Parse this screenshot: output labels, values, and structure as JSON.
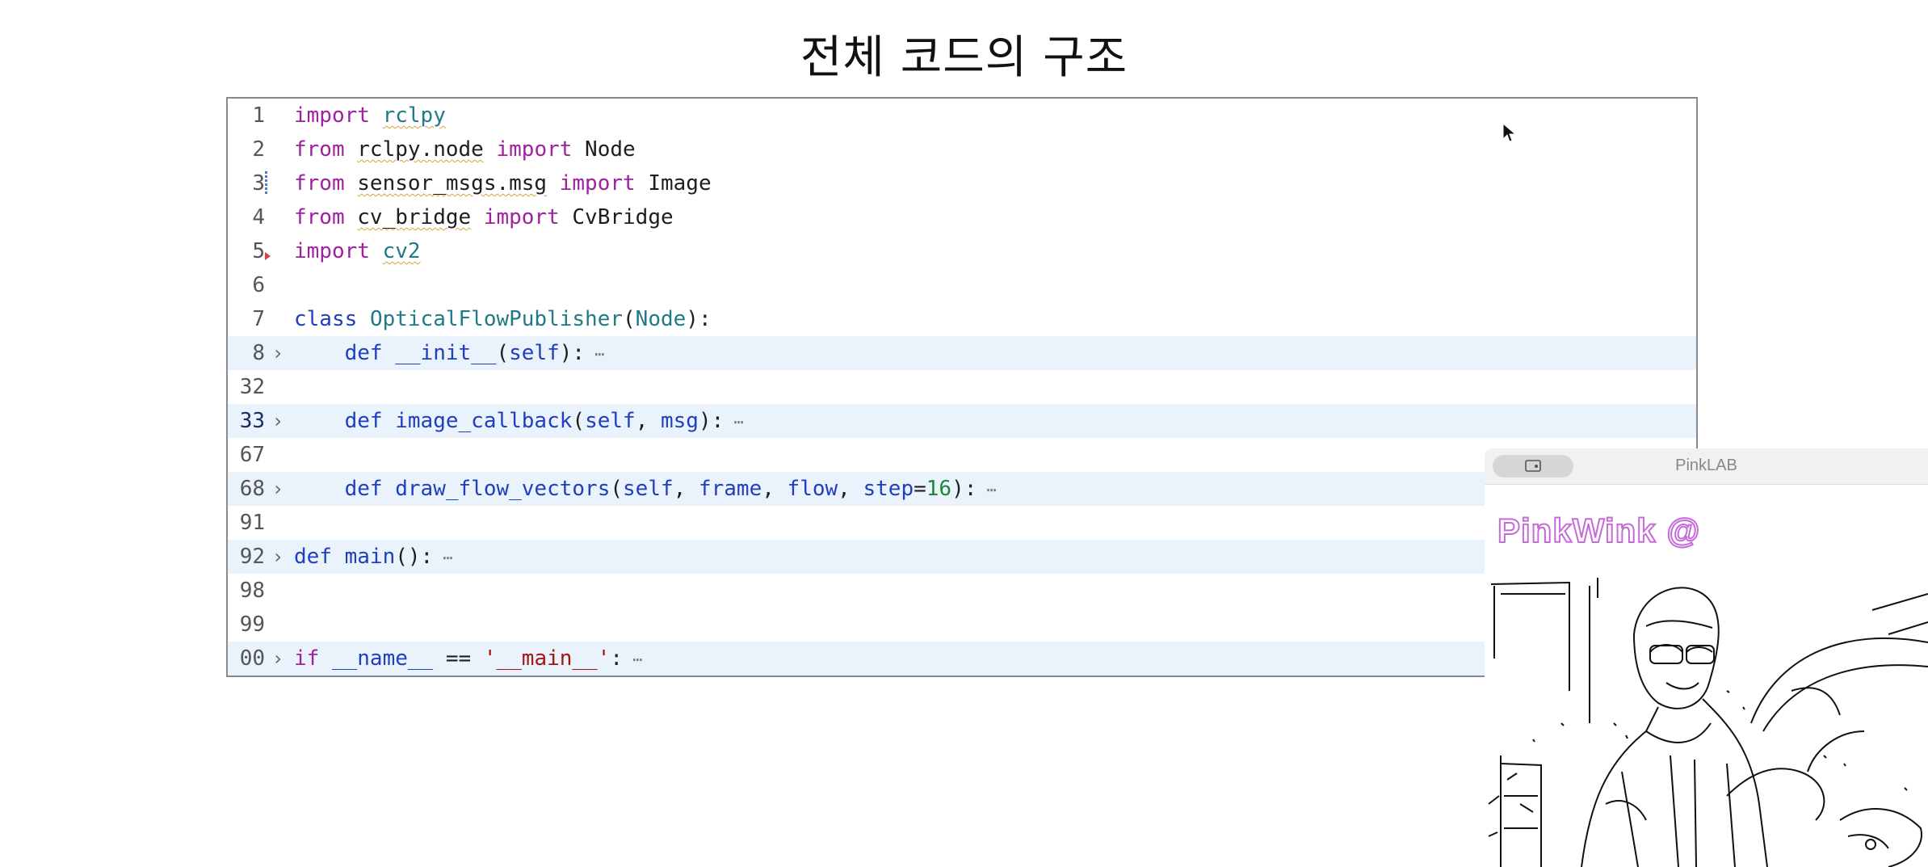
{
  "slide": {
    "title": "전체 코드의 구조"
  },
  "editor": {
    "lines": [
      {
        "num": "1",
        "tokens": [
          [
            "import",
            "kw-purple"
          ],
          [
            " ",
            ""
          ],
          [
            "rclpy",
            "teal wavy"
          ]
        ]
      },
      {
        "num": "2",
        "tokens": [
          [
            "from",
            "kw-purple"
          ],
          [
            " ",
            ""
          ],
          [
            "rclpy.node",
            "wavy"
          ],
          [
            " ",
            ""
          ],
          [
            "import",
            "kw-purple"
          ],
          [
            " Node",
            ""
          ]
        ]
      },
      {
        "num": "3",
        "tokens": [
          [
            "from",
            "kw-purple"
          ],
          [
            " ",
            ""
          ],
          [
            "sensor_msgs.msg",
            "wavy"
          ],
          [
            " ",
            ""
          ],
          [
            "import",
            "kw-purple"
          ],
          [
            " Image",
            ""
          ]
        ]
      },
      {
        "num": "4",
        "tokens": [
          [
            "from",
            "kw-purple"
          ],
          [
            " ",
            ""
          ],
          [
            "cv_bridge",
            "wavy"
          ],
          [
            " ",
            ""
          ],
          [
            "import",
            "kw-purple"
          ],
          [
            " CvBridge",
            ""
          ]
        ]
      },
      {
        "num": "5",
        "tokens": [
          [
            "import",
            "kw-purple"
          ],
          [
            " ",
            ""
          ],
          [
            "cv2",
            "teal wavy"
          ]
        ]
      },
      {
        "num": "6",
        "tokens": []
      },
      {
        "num": "7",
        "tokens": [
          [
            "class",
            "kw-blue"
          ],
          [
            " ",
            ""
          ],
          [
            "OpticalFlowPublisher",
            "teal"
          ],
          [
            "(",
            ""
          ],
          [
            "Node",
            "teal"
          ],
          [
            "):",
            ""
          ]
        ]
      },
      {
        "num": "8",
        "tokens": [
          [
            "    ",
            ""
          ],
          [
            "def",
            "kw-blue"
          ],
          [
            " ",
            ""
          ],
          [
            "__init__",
            "kw-blue"
          ],
          [
            "(",
            ""
          ],
          [
            "self",
            "kw-blue"
          ],
          [
            "):",
            ""
          ],
          [
            " ⋯",
            "ellipsis"
          ]
        ]
      },
      {
        "num": "32",
        "tokens": []
      },
      {
        "num": "33",
        "tokens": [
          [
            "    ",
            ""
          ],
          [
            "def",
            "kw-blue"
          ],
          [
            " ",
            ""
          ],
          [
            "image_callback",
            "kw-blue"
          ],
          [
            "(",
            ""
          ],
          [
            "self",
            "kw-blue"
          ],
          [
            ", ",
            ""
          ],
          [
            "msg",
            "kw-blue"
          ],
          [
            "):",
            ""
          ],
          [
            " ⋯",
            "ellipsis"
          ]
        ]
      },
      {
        "num": "67",
        "tokens": []
      },
      {
        "num": "68",
        "tokens": [
          [
            "    ",
            ""
          ],
          [
            "def",
            "kw-blue"
          ],
          [
            " ",
            ""
          ],
          [
            "draw_flow_vectors",
            "kw-blue"
          ],
          [
            "(",
            ""
          ],
          [
            "self",
            "kw-blue"
          ],
          [
            ", ",
            ""
          ],
          [
            "frame",
            "kw-blue"
          ],
          [
            ", ",
            ""
          ],
          [
            "flow",
            "kw-blue"
          ],
          [
            ", ",
            ""
          ],
          [
            "step",
            "kw-blue"
          ],
          [
            "=",
            ""
          ],
          [
            "16",
            "num"
          ],
          [
            "):",
            ""
          ],
          [
            " ⋯",
            "ellipsis"
          ]
        ]
      },
      {
        "num": "91",
        "tokens": []
      },
      {
        "num": "92",
        "tokens": [
          [
            "def",
            "kw-blue"
          ],
          [
            " ",
            ""
          ],
          [
            "main",
            "kw-blue"
          ],
          [
            "():",
            ""
          ],
          [
            " ⋯",
            "ellipsis"
          ]
        ]
      },
      {
        "num": "98",
        "tokens": []
      },
      {
        "num": "99",
        "tokens": []
      },
      {
        "num": "00",
        "tokens": [
          [
            "if",
            "kw-purple"
          ],
          [
            " ",
            ""
          ],
          [
            "__name__",
            "kw-blue"
          ],
          [
            " == ",
            ""
          ],
          [
            "'__main__'",
            "str"
          ],
          [
            ":",
            ""
          ],
          [
            " ⋯",
            "ellipsis"
          ]
        ]
      }
    ]
  },
  "webcam": {
    "window_title": "PinkLAB",
    "brand_text": "PinkWink @"
  },
  "icons": {
    "fold": "chevron-right-icon",
    "cursor": "mouse-cursor-icon"
  }
}
